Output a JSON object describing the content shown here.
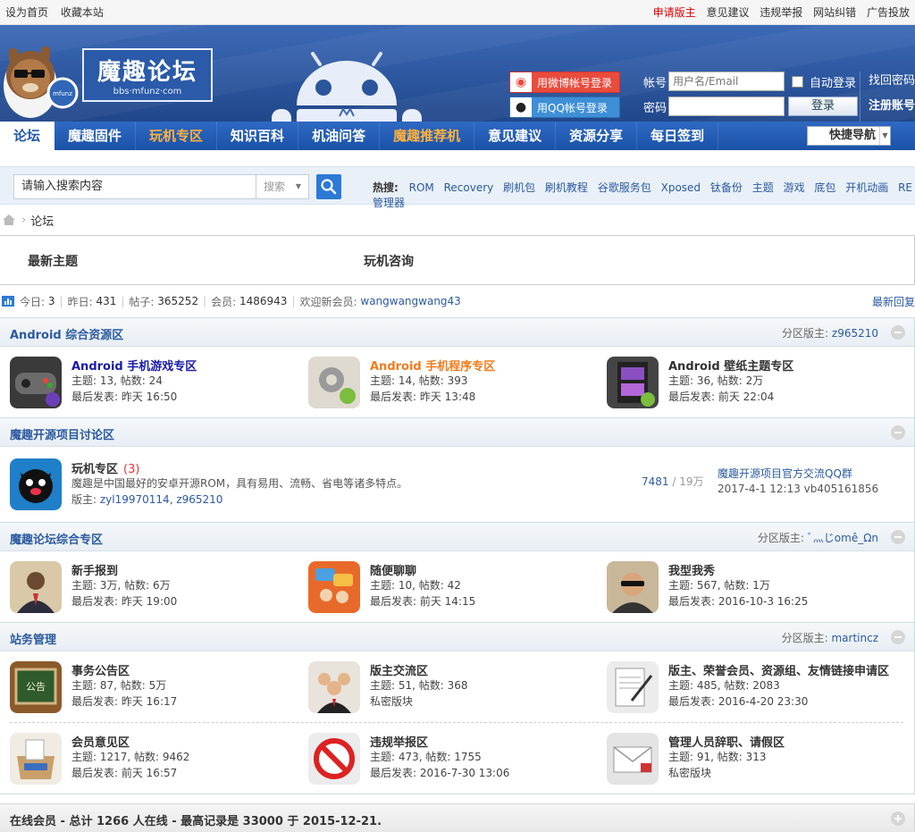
{
  "topbar": {
    "left": [
      "设为首页",
      "收藏本站"
    ],
    "right": [
      "申请版主",
      "意见建议",
      "违规举报",
      "网站纠错",
      "广告投放"
    ]
  },
  "header": {
    "logo_title": "魔趣论坛",
    "logo_sub": "bbs·mfunz·com",
    "weibo_login": "用微博帐号登录",
    "qq_login": "用QQ帐号登录",
    "account_label": "帐号",
    "account_placeholder": "用户名/Email",
    "auto_login": "自动登录",
    "password_label": "密码",
    "login_button": "登录",
    "forgot": "找回密码",
    "register": "注册账号"
  },
  "nav": {
    "items": [
      "论坛",
      "魔趣固件",
      "玩机专区",
      "知识百科",
      "机油问答",
      "魔趣推荐机",
      "意见建议",
      "资源分享",
      "每日签到"
    ],
    "quick": "快捷导航"
  },
  "search": {
    "placeholder": "请输入搜索内容",
    "select": "搜索",
    "hot_label": "热搜:",
    "hot": [
      "ROM",
      "Recovery",
      "刷机包",
      "刷机教程",
      "谷歌服务包",
      "Xposed",
      "钛备份",
      "主题",
      "游戏",
      "底包",
      "开机动画",
      "RE管理器"
    ]
  },
  "crumb": {
    "label": "论坛"
  },
  "tabs": {
    "newest": "最新主题",
    "consult": "玩机咨询"
  },
  "stats": {
    "today_label": "今日:",
    "today": "3",
    "yesterday_label": "昨日:",
    "yesterday": "431",
    "posts_label": "帖子:",
    "posts": "365252",
    "members_label": "会员:",
    "members": "1486943",
    "welcome_label": "欢迎新会员:",
    "new_member": "wangwangwang43",
    "latest_reply": "最新回复"
  },
  "cats": {
    "android": {
      "title": "Android 综合资源区",
      "mod_label": "分区版主:",
      "mod": "z965210",
      "forums": [
        {
          "name": "Android 手机游戏专区",
          "stats": "主题: 13, 帖数: 24",
          "last": "最后发表: 昨天 16:50",
          "color": "#1a1aa6"
        },
        {
          "name": "Android 手机程序专区",
          "stats": "主题: 14, 帖数: 393",
          "last": "最后发表: 昨天 13:48",
          "color": "#f07c1c"
        },
        {
          "name": "Android 壁纸主题专区",
          "stats": "主题: 36, 帖数: 2万",
          "last": "最后发表: 前天 22:04",
          "color": "#333333"
        }
      ]
    },
    "opensource": {
      "title": "魔趣开源项目讨论区",
      "forum_name": "玩机专区",
      "forum_count": "(3)",
      "desc": "魔趣是中国最好的安卓开源ROM，具有易用、流畅、省电等诸多特点。",
      "mods_label": "版主:",
      "mods": [
        "zyl19970114",
        "z965210"
      ],
      "topics": "7481",
      "posts": "19万",
      "last_title": "魔趣开源项目官方交流QQ群",
      "last_info": "2017-4-1 12:13 vb405161856"
    },
    "general": {
      "title": "魔趣论坛综合专区",
      "mod_label": "分区版主:",
      "mod": "ﾞ灬じomê_Ωn",
      "forums": [
        {
          "name": "新手报到",
          "stats": "主题: 3万, 帖数: 6万",
          "last": "最后发表: 昨天 19:00"
        },
        {
          "name": "随便聊聊",
          "stats": "主题: 10, 帖数: 42",
          "last": "最后发表: 前天 14:15"
        },
        {
          "name": "我型我秀",
          "stats": "主题: 567, 帖数: 1万",
          "last": "最后发表: 2016-10-3 16:25"
        }
      ]
    },
    "admin": {
      "title": "站务管理",
      "mod_label": "分区版主:",
      "mod": "martincz",
      "forums": [
        {
          "name": "事务公告区",
          "stats": "主题: 87, 帖数: 5万",
          "last": "最后发表: 昨天 16:17"
        },
        {
          "name": "版主交流区",
          "stats": "主题: 51, 帖数: 368",
          "last": "私密版块"
        },
        {
          "name": "版主、荣誉会员、资源组、友情链接申请区",
          "stats": "主题: 485, 帖数: 2083",
          "last": "最后发表: 2016-4-20 23:30"
        },
        {
          "name": "会员意见区",
          "stats": "主题: 1217, 帖数: 9462",
          "last": "最后发表: 前天 16:57"
        },
        {
          "name": "违规举报区",
          "stats": "主题: 473, 帖数: 1755",
          "last": "最后发表: 2016-7-30 13:06"
        },
        {
          "name": "管理人员辞职、请假区",
          "stats": "主题: 91, 帖数: 313",
          "last": "私密版块"
        }
      ]
    }
  },
  "online": {
    "text": "在线会员 - 总计 1266 人在线 - 最高记录是 33000 于 2015-12-21."
  }
}
